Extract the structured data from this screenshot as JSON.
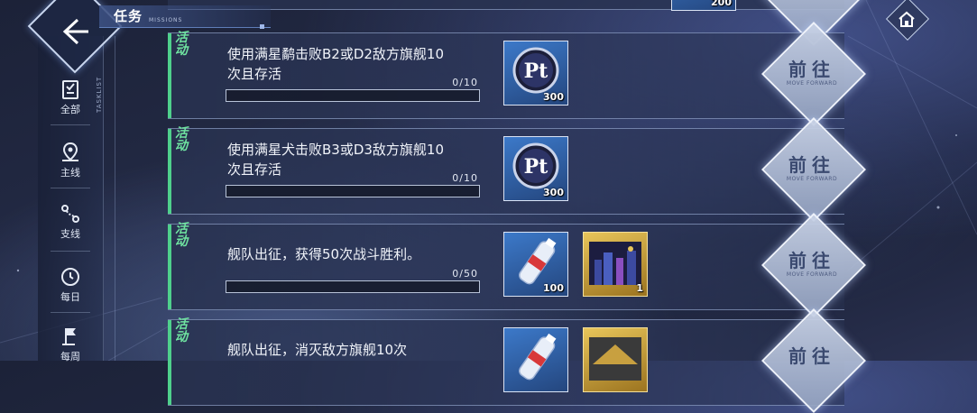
{
  "header": {
    "title": "任务",
    "subtitle": "MISSIONS",
    "tasklist_label": "TASKLIST"
  },
  "top_stub": {
    "reward_qty": "200"
  },
  "sidebar": {
    "items": [
      {
        "label": "全部",
        "icon": "checklist-icon"
      },
      {
        "label": "主线",
        "icon": "map-pin-icon"
      },
      {
        "label": "支线",
        "icon": "route-icon"
      },
      {
        "label": "每日",
        "icon": "clock-icon"
      },
      {
        "label": "每周",
        "icon": "flag-icon"
      }
    ]
  },
  "missions": [
    {
      "tag": "活动",
      "desc": "使用满星鹬击败B2或D2敌方旗舰10次且存活",
      "progress_text": "0/10",
      "progress": 0,
      "rewards": [
        {
          "icon": "pt-token-icon",
          "qty": "300"
        }
      ],
      "go_label": "前往",
      "go_sub": "MOVE FORWARD"
    },
    {
      "tag": "活动",
      "desc": "使用满星犬击败B3或D3敌方旗舰10次且存活",
      "progress_text": "0/10",
      "progress": 0,
      "rewards": [
        {
          "icon": "pt-token-icon",
          "qty": "300"
        }
      ],
      "go_label": "前往",
      "go_sub": "MOVE FORWARD"
    },
    {
      "tag": "活动",
      "desc": "舰队出征，获得50次战斗胜利。",
      "progress_text": "0/50",
      "progress": 0,
      "rewards": [
        {
          "icon": "water-bottle-icon",
          "qty": "100"
        },
        {
          "icon": "city-poster-icon",
          "qty": "1"
        }
      ],
      "go_label": "前往",
      "go_sub": "MOVE FORWARD"
    },
    {
      "tag": "活动",
      "desc": "舰队出征，消灭敌方旗舰10次",
      "progress_text": "",
      "progress": 0,
      "rewards": [
        {
          "icon": "water-bottle-icon",
          "qty": ""
        },
        {
          "icon": "city-poster-icon",
          "qty": ""
        }
      ],
      "go_label": "前往",
      "go_sub": "MOVE FORWARD"
    }
  ]
}
